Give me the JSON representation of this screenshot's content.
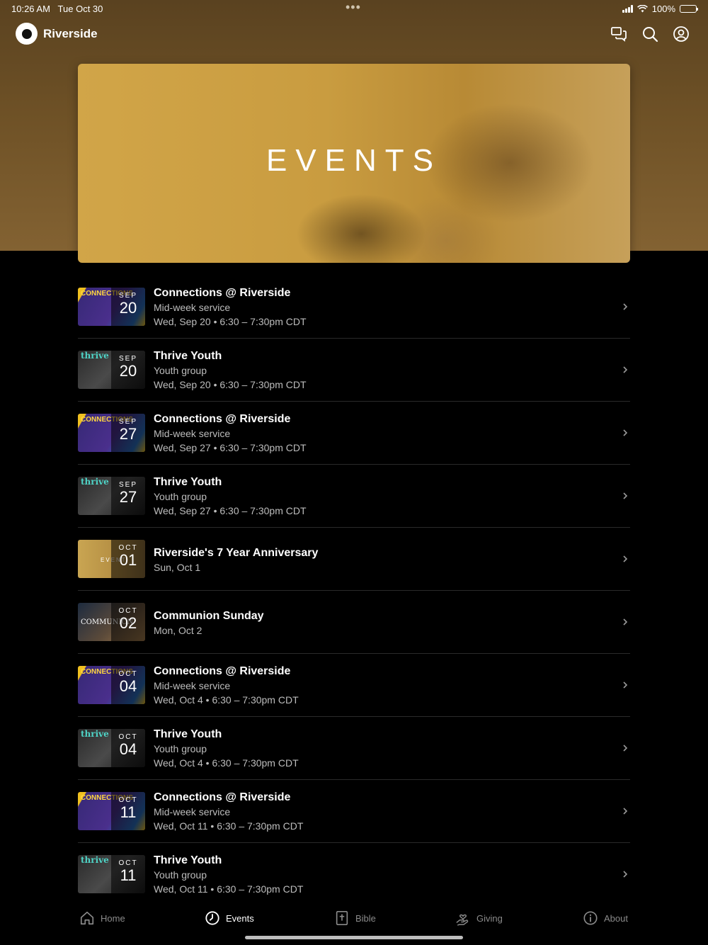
{
  "status_bar": {
    "time": "10:26 AM",
    "date": "Tue Oct 30",
    "battery": "100%"
  },
  "header": {
    "app_title": "Riverside"
  },
  "hero": {
    "title": "EVENTS"
  },
  "events": [
    {
      "title": "Connections @ Riverside",
      "subtitle": "Mid-week service",
      "datetime": "Wed, Sep 20 • 6:30 – 7:30pm CDT",
      "month": "SEP",
      "day": "20",
      "thumb": "connections",
      "thumb_label": "CONNECTIONS"
    },
    {
      "title": "Thrive Youth",
      "subtitle": "Youth group",
      "datetime": "Wed, Sep 20 • 6:30 – 7:30pm CDT",
      "month": "SEP",
      "day": "20",
      "thumb": "thrive",
      "thumb_label": "thrive"
    },
    {
      "title": "Connections @ Riverside",
      "subtitle": "Mid-week service",
      "datetime": "Wed, Sep 27 • 6:30 – 7:30pm CDT",
      "month": "SEP",
      "day": "27",
      "thumb": "connections",
      "thumb_label": "CONNECTIONS"
    },
    {
      "title": "Thrive Youth",
      "subtitle": "Youth group",
      "datetime": "Wed, Sep 27 • 6:30 – 7:30pm CDT",
      "month": "SEP",
      "day": "27",
      "thumb": "thrive",
      "thumb_label": "thrive"
    },
    {
      "title": "Riverside's 7 Year Anniversary",
      "subtitle": "Sun, Oct 1",
      "datetime": "",
      "month": "OCT",
      "day": "01",
      "thumb": "anniversary",
      "thumb_label": "EVENT"
    },
    {
      "title": "Communion Sunday",
      "subtitle": "Mon, Oct 2",
      "datetime": "",
      "month": "OCT",
      "day": "02",
      "thumb": "communion",
      "thumb_label": "COMMUNION"
    },
    {
      "title": "Connections @ Riverside",
      "subtitle": "Mid-week service",
      "datetime": "Wed, Oct 4 • 6:30 – 7:30pm CDT",
      "month": "OCT",
      "day": "04",
      "thumb": "connections",
      "thumb_label": "CONNECTIONS"
    },
    {
      "title": "Thrive Youth",
      "subtitle": "Youth group",
      "datetime": "Wed, Oct 4 • 6:30 – 7:30pm CDT",
      "month": "OCT",
      "day": "04",
      "thumb": "thrive",
      "thumb_label": "thrive"
    },
    {
      "title": "Connections @ Riverside",
      "subtitle": "Mid-week service",
      "datetime": "Wed, Oct 11 • 6:30 – 7:30pm CDT",
      "month": "OCT",
      "day": "11",
      "thumb": "connections",
      "thumb_label": "CONNECTIONS"
    },
    {
      "title": "Thrive Youth",
      "subtitle": "Youth group",
      "datetime": "Wed, Oct 11 • 6:30 – 7:30pm CDT",
      "month": "OCT",
      "day": "11",
      "thumb": "thrive",
      "thumb_label": "thrive"
    }
  ],
  "tabs": [
    {
      "label": "Home",
      "icon": "home-icon",
      "active": false
    },
    {
      "label": "Events",
      "icon": "clock-icon",
      "active": true
    },
    {
      "label": "Bible",
      "icon": "bible-icon",
      "active": false
    },
    {
      "label": "Giving",
      "icon": "giving-icon",
      "active": false
    },
    {
      "label": "About",
      "icon": "info-icon",
      "active": false
    }
  ],
  "colors": {
    "header_brown": "#6e5126",
    "hero_gold": "#c99c40",
    "background": "#000000",
    "tab_inactive": "#8a8a8a"
  }
}
